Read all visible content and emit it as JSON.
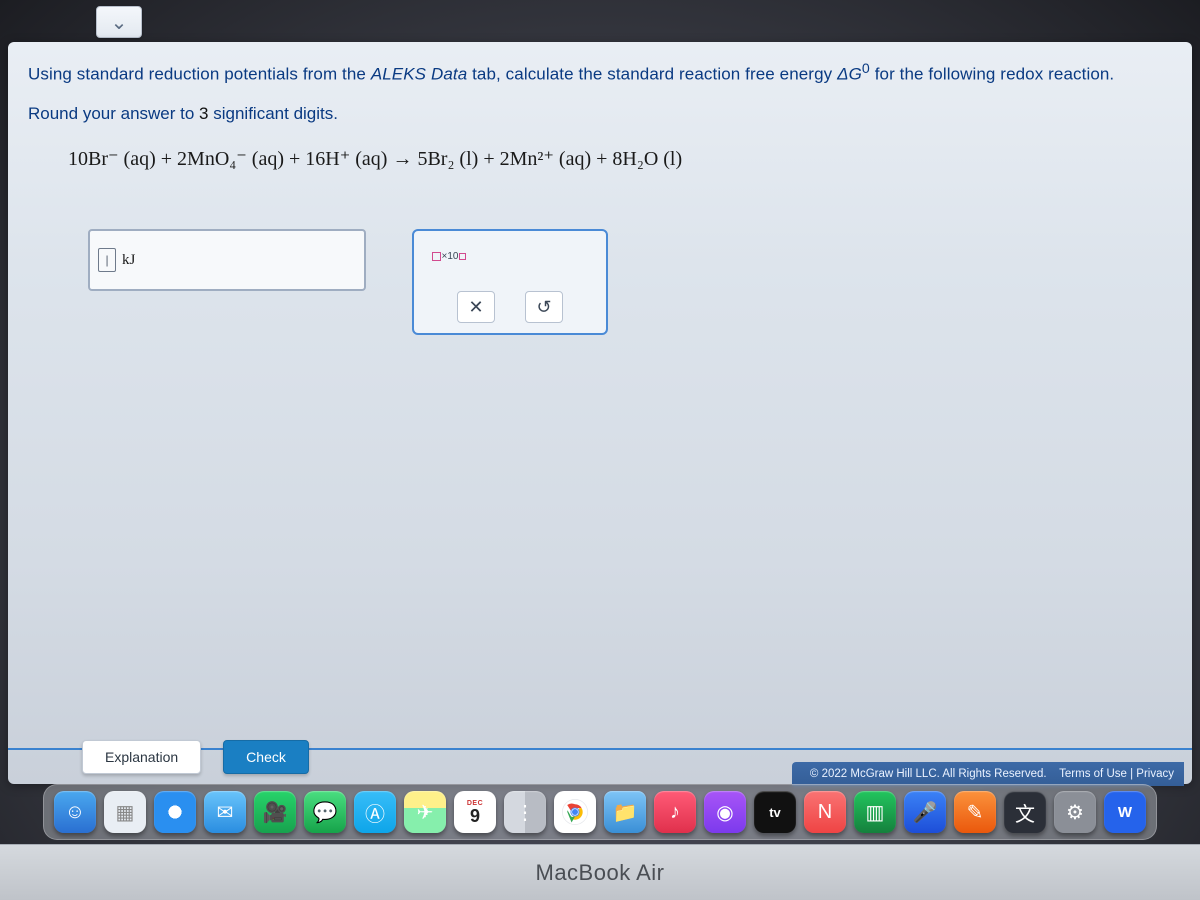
{
  "dropdown": {
    "glyph": "⌄"
  },
  "question": {
    "line1_a": "Using standard reduction potentials from the ",
    "line1_b": "ALEKS Data",
    "line1_c": " tab, calculate the standard reaction free energy ",
    "line1_dG": "ΔG",
    "line1_sup": "0",
    "line1_d": " for the following redox reaction.",
    "line2_a": "Round your answer to ",
    "line2_b": "3",
    "line2_c": " significant digits."
  },
  "equation": {
    "text": "10Br⁻ (aq) + 2MnO₄⁻ (aq) + 16H⁺ (aq) → 5Br₂ (l) + 2Mn²⁺ (aq) + 8H₂O (l)"
  },
  "answer": {
    "unit": "kJ",
    "value": "",
    "placeholder": ""
  },
  "tools": {
    "x10_label": "×10",
    "clear_glyph": "✕",
    "reset_glyph": "↺"
  },
  "buttons": {
    "explanation": "Explanation",
    "check": "Check"
  },
  "footer": {
    "copyright": "© 2022 McGraw Hill LLC. All Rights Reserved.",
    "terms": "Terms of Use",
    "sep": " | ",
    "privacy": "Privacy"
  },
  "calendar": {
    "month": "DEC",
    "day": "9"
  },
  "tv": {
    "label": "tv"
  },
  "word": {
    "label": "W"
  },
  "bezel": {
    "label": "MacBook Air"
  }
}
